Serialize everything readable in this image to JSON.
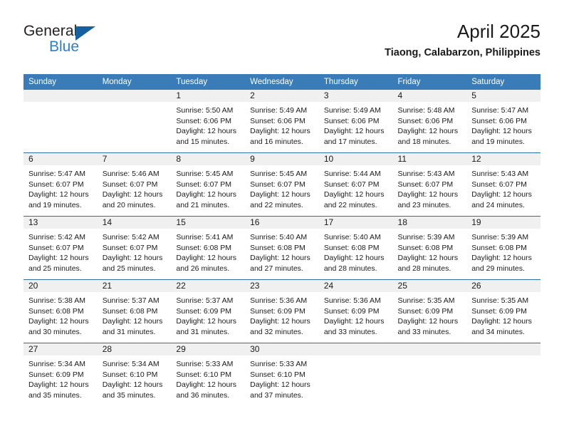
{
  "brand": {
    "name_part1": "General",
    "name_part2": "Blue",
    "triangle_color": "#15609f",
    "blue_text_color": "#2a7fd4"
  },
  "header": {
    "title": "April 2025",
    "subtitle": "Tiaong, Calabarzon, Philippines"
  },
  "theme": {
    "header_blue": "#3a7cb8",
    "rule_blue": "#2f6da8",
    "daynum_band": "#f0f0f0"
  },
  "calendar": {
    "weekdays": [
      "Sunday",
      "Monday",
      "Tuesday",
      "Wednesday",
      "Thursday",
      "Friday",
      "Saturday"
    ],
    "weeks": [
      [
        {
          "day": "",
          "lines": []
        },
        {
          "day": "",
          "lines": []
        },
        {
          "day": "1",
          "lines": [
            "Sunrise: 5:50 AM",
            "Sunset: 6:06 PM",
            "Daylight: 12 hours",
            "and 15 minutes."
          ]
        },
        {
          "day": "2",
          "lines": [
            "Sunrise: 5:49 AM",
            "Sunset: 6:06 PM",
            "Daylight: 12 hours",
            "and 16 minutes."
          ]
        },
        {
          "day": "3",
          "lines": [
            "Sunrise: 5:49 AM",
            "Sunset: 6:06 PM",
            "Daylight: 12 hours",
            "and 17 minutes."
          ]
        },
        {
          "day": "4",
          "lines": [
            "Sunrise: 5:48 AM",
            "Sunset: 6:06 PM",
            "Daylight: 12 hours",
            "and 18 minutes."
          ]
        },
        {
          "day": "5",
          "lines": [
            "Sunrise: 5:47 AM",
            "Sunset: 6:06 PM",
            "Daylight: 12 hours",
            "and 19 minutes."
          ]
        }
      ],
      [
        {
          "day": "6",
          "lines": [
            "Sunrise: 5:47 AM",
            "Sunset: 6:07 PM",
            "Daylight: 12 hours",
            "and 19 minutes."
          ]
        },
        {
          "day": "7",
          "lines": [
            "Sunrise: 5:46 AM",
            "Sunset: 6:07 PM",
            "Daylight: 12 hours",
            "and 20 minutes."
          ]
        },
        {
          "day": "8",
          "lines": [
            "Sunrise: 5:45 AM",
            "Sunset: 6:07 PM",
            "Daylight: 12 hours",
            "and 21 minutes."
          ]
        },
        {
          "day": "9",
          "lines": [
            "Sunrise: 5:45 AM",
            "Sunset: 6:07 PM",
            "Daylight: 12 hours",
            "and 22 minutes."
          ]
        },
        {
          "day": "10",
          "lines": [
            "Sunrise: 5:44 AM",
            "Sunset: 6:07 PM",
            "Daylight: 12 hours",
            "and 22 minutes."
          ]
        },
        {
          "day": "11",
          "lines": [
            "Sunrise: 5:43 AM",
            "Sunset: 6:07 PM",
            "Daylight: 12 hours",
            "and 23 minutes."
          ]
        },
        {
          "day": "12",
          "lines": [
            "Sunrise: 5:43 AM",
            "Sunset: 6:07 PM",
            "Daylight: 12 hours",
            "and 24 minutes."
          ]
        }
      ],
      [
        {
          "day": "13",
          "lines": [
            "Sunrise: 5:42 AM",
            "Sunset: 6:07 PM",
            "Daylight: 12 hours",
            "and 25 minutes."
          ]
        },
        {
          "day": "14",
          "lines": [
            "Sunrise: 5:42 AM",
            "Sunset: 6:07 PM",
            "Daylight: 12 hours",
            "and 25 minutes."
          ]
        },
        {
          "day": "15",
          "lines": [
            "Sunrise: 5:41 AM",
            "Sunset: 6:08 PM",
            "Daylight: 12 hours",
            "and 26 minutes."
          ]
        },
        {
          "day": "16",
          "lines": [
            "Sunrise: 5:40 AM",
            "Sunset: 6:08 PM",
            "Daylight: 12 hours",
            "and 27 minutes."
          ]
        },
        {
          "day": "17",
          "lines": [
            "Sunrise: 5:40 AM",
            "Sunset: 6:08 PM",
            "Daylight: 12 hours",
            "and 28 minutes."
          ]
        },
        {
          "day": "18",
          "lines": [
            "Sunrise: 5:39 AM",
            "Sunset: 6:08 PM",
            "Daylight: 12 hours",
            "and 28 minutes."
          ]
        },
        {
          "day": "19",
          "lines": [
            "Sunrise: 5:39 AM",
            "Sunset: 6:08 PM",
            "Daylight: 12 hours",
            "and 29 minutes."
          ]
        }
      ],
      [
        {
          "day": "20",
          "lines": [
            "Sunrise: 5:38 AM",
            "Sunset: 6:08 PM",
            "Daylight: 12 hours",
            "and 30 minutes."
          ]
        },
        {
          "day": "21",
          "lines": [
            "Sunrise: 5:37 AM",
            "Sunset: 6:08 PM",
            "Daylight: 12 hours",
            "and 31 minutes."
          ]
        },
        {
          "day": "22",
          "lines": [
            "Sunrise: 5:37 AM",
            "Sunset: 6:09 PM",
            "Daylight: 12 hours",
            "and 31 minutes."
          ]
        },
        {
          "day": "23",
          "lines": [
            "Sunrise: 5:36 AM",
            "Sunset: 6:09 PM",
            "Daylight: 12 hours",
            "and 32 minutes."
          ]
        },
        {
          "day": "24",
          "lines": [
            "Sunrise: 5:36 AM",
            "Sunset: 6:09 PM",
            "Daylight: 12 hours",
            "and 33 minutes."
          ]
        },
        {
          "day": "25",
          "lines": [
            "Sunrise: 5:35 AM",
            "Sunset: 6:09 PM",
            "Daylight: 12 hours",
            "and 33 minutes."
          ]
        },
        {
          "day": "26",
          "lines": [
            "Sunrise: 5:35 AM",
            "Sunset: 6:09 PM",
            "Daylight: 12 hours",
            "and 34 minutes."
          ]
        }
      ],
      [
        {
          "day": "27",
          "lines": [
            "Sunrise: 5:34 AM",
            "Sunset: 6:09 PM",
            "Daylight: 12 hours",
            "and 35 minutes."
          ]
        },
        {
          "day": "28",
          "lines": [
            "Sunrise: 5:34 AM",
            "Sunset: 6:10 PM",
            "Daylight: 12 hours",
            "and 35 minutes."
          ]
        },
        {
          "day": "29",
          "lines": [
            "Sunrise: 5:33 AM",
            "Sunset: 6:10 PM",
            "Daylight: 12 hours",
            "and 36 minutes."
          ]
        },
        {
          "day": "30",
          "lines": [
            "Sunrise: 5:33 AM",
            "Sunset: 6:10 PM",
            "Daylight: 12 hours",
            "and 37 minutes."
          ]
        },
        {
          "day": "",
          "lines": []
        },
        {
          "day": "",
          "lines": []
        },
        {
          "day": "",
          "lines": []
        }
      ]
    ]
  }
}
